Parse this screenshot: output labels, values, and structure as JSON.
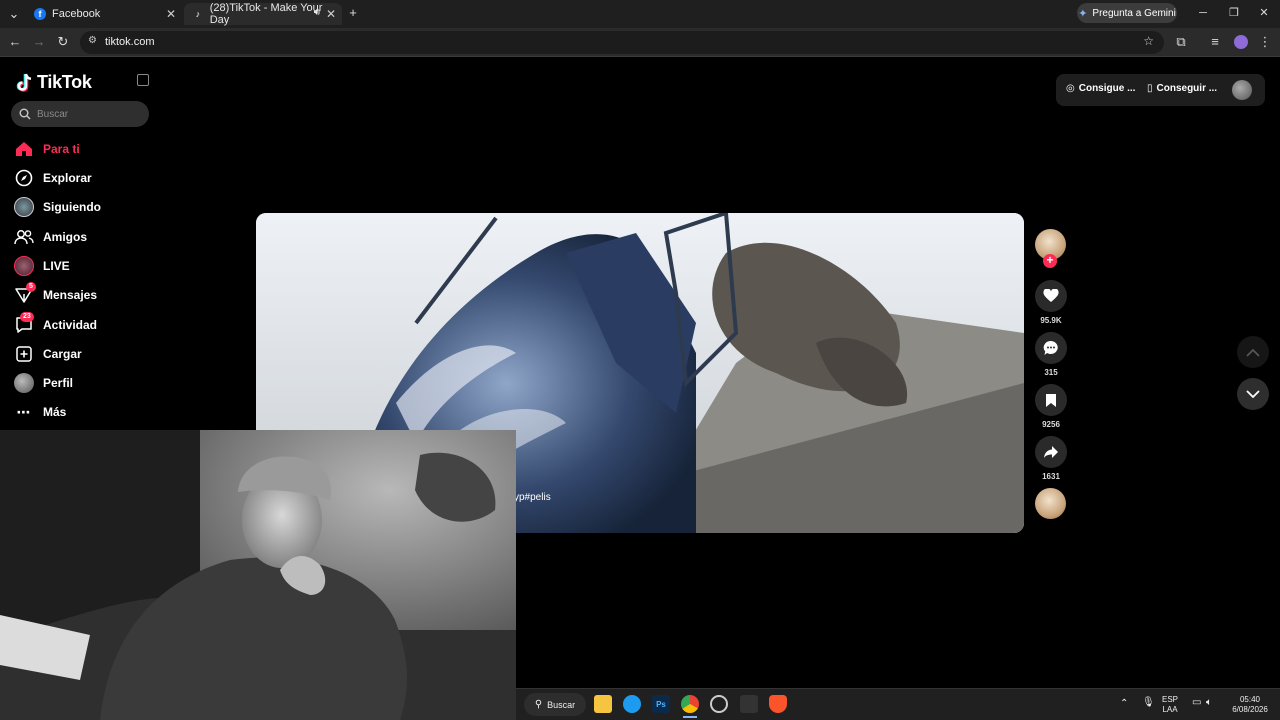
{
  "browser": {
    "tabs": [
      {
        "label": "Facebook",
        "active": false
      },
      {
        "label": "(28)TikTok - Make Your Day",
        "active": true
      }
    ],
    "new_tab": "+",
    "gemini_label": "Pregunta a Gemini",
    "url": "tiktok.com"
  },
  "sidebar": {
    "logo": "TikTok",
    "search_placeholder": "Buscar",
    "items": [
      {
        "label": "Para ti",
        "icon": "home-icon",
        "active": true
      },
      {
        "label": "Explorar",
        "icon": "compass-icon"
      },
      {
        "label": "Siguiendo",
        "icon": "following-avatar"
      },
      {
        "label": "Amigos",
        "icon": "friends-icon"
      },
      {
        "label": "LIVE",
        "icon": "live-avatar"
      },
      {
        "label": "Mensajes",
        "icon": "messages-icon",
        "badge": "5"
      },
      {
        "label": "Actividad",
        "icon": "activity-icon",
        "badge": "23"
      },
      {
        "label": "Cargar",
        "icon": "upload-icon"
      },
      {
        "label": "Perfil",
        "icon": "profile-avatar"
      },
      {
        "label": "Más",
        "icon": "more-icon"
      }
    ]
  },
  "topright": {
    "coins_label": "Consigue ...",
    "app_label": "Conseguir ..."
  },
  "video": {
    "caption": "yp#pelis"
  },
  "actions": {
    "likes": "95.9K",
    "comments": "315",
    "saves": "9256",
    "shares": "1631"
  },
  "taskbar": {
    "search_label": "Buscar",
    "lang_top": "ESP",
    "lang_bottom": "LAA",
    "time": "05:40",
    "date": "6/08/2026"
  },
  "colors": {
    "accent": "#fe2c55",
    "background": "#000000",
    "chrome": "#202020"
  }
}
